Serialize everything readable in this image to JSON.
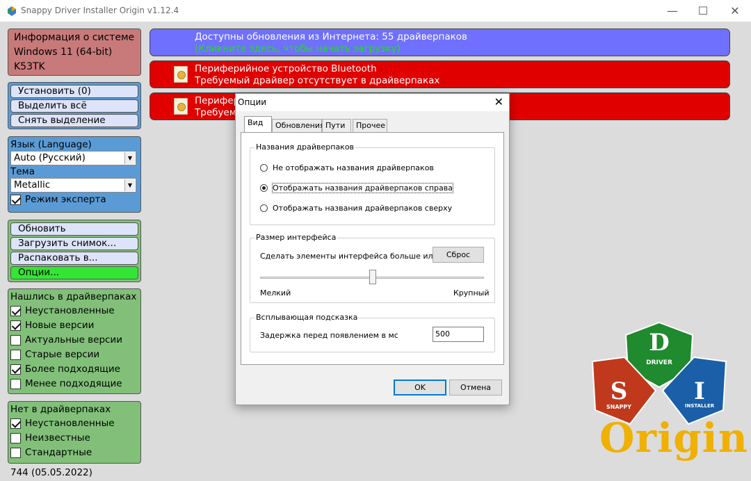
{
  "window": {
    "title": "Snappy Driver Installer Origin v1.12.4",
    "minimize": "—",
    "maximize": "☐",
    "close": "✕"
  },
  "sysinfo": {
    "line1": "Информация о системе",
    "line2": "Windows 11 (64-bit)",
    "line3": "K53TK"
  },
  "actions": {
    "install": "Установить (0)",
    "select_all": "Выделить всё",
    "deselect": "Снять выделение"
  },
  "language": {
    "label": "Язык (Language)",
    "value": "Auto (Русский)",
    "theme_label": "Тема",
    "theme_value": "Metallic",
    "expert_mode": "Режим эксперта",
    "expert_checked": true
  },
  "operations": {
    "refresh": "Обновить",
    "load_snapshot": "Загрузить снимок...",
    "extract": "Распаковать в...",
    "options": "Опции..."
  },
  "found": {
    "header": "Нашлись в драйверпаках",
    "items": [
      {
        "label": "Неустановленные",
        "checked": true
      },
      {
        "label": "Новые версии",
        "checked": true
      },
      {
        "label": "Актуальные версии",
        "checked": false
      },
      {
        "label": "Старые версии",
        "checked": false
      },
      {
        "label": "Более подходящие",
        "checked": true
      },
      {
        "label": "Менее подходящие",
        "checked": false
      }
    ]
  },
  "notfound": {
    "header": "Нет в драйверпаках",
    "items": [
      {
        "label": "Неустановленные",
        "checked": true
      },
      {
        "label": "Неизвестные",
        "checked": false
      },
      {
        "label": "Стандартные",
        "checked": false
      }
    ]
  },
  "version": "744 (05.05.2022)",
  "drivers": {
    "update": {
      "line1": "Доступны обновления из Интернета: 55 драйверпаков",
      "line2": "(Кликните здесь, чтобы начать загрузку)"
    },
    "item1": {
      "line1": "Периферийное устройство Bluetooth",
      "line2": "Требуемый драйвер отсутствует в драйверпаках"
    },
    "item2": {
      "line1": "Перифер",
      "line2": "Требуем"
    }
  },
  "dialog": {
    "title": "Опции",
    "close": "✕",
    "tabs": [
      "Вид",
      "Обновления",
      "Пути",
      "Прочее"
    ],
    "names_group": "Названия драйверпаков",
    "radio": [
      {
        "label": "Не отображать названия драйверпаков",
        "selected": false
      },
      {
        "label": "Отображать названия драйверпаков справа",
        "selected": true
      },
      {
        "label": "Отображать названия драйверпаков сверху",
        "selected": false
      }
    ],
    "size_group": "Размер интерфейса",
    "size_desc": "Сделать элементы интерфейса больше или мень",
    "reset": "Сброс",
    "small": "Мелкий",
    "large": "Крупный",
    "slider_level_percent": 50,
    "tooltip_group": "Всплывающая подсказка",
    "tooltip_label": "Задержка перед появлением в мс",
    "tooltip_value": "500",
    "ok": "OK",
    "cancel": "Отмена"
  },
  "logo": {
    "d": "D",
    "driver": "DRIVER",
    "s": "S",
    "snappy": "SNAPPY",
    "i": "I",
    "installer": "INSTALLER",
    "origin": "Origin"
  },
  "colors": {
    "update_bg": "#7070ff",
    "error_bg": "#e00000",
    "panel_blue": "#5b9bd5",
    "panel_green": "#82c07a",
    "panel_red": "#c87a7a",
    "options_green": "#33e633"
  }
}
